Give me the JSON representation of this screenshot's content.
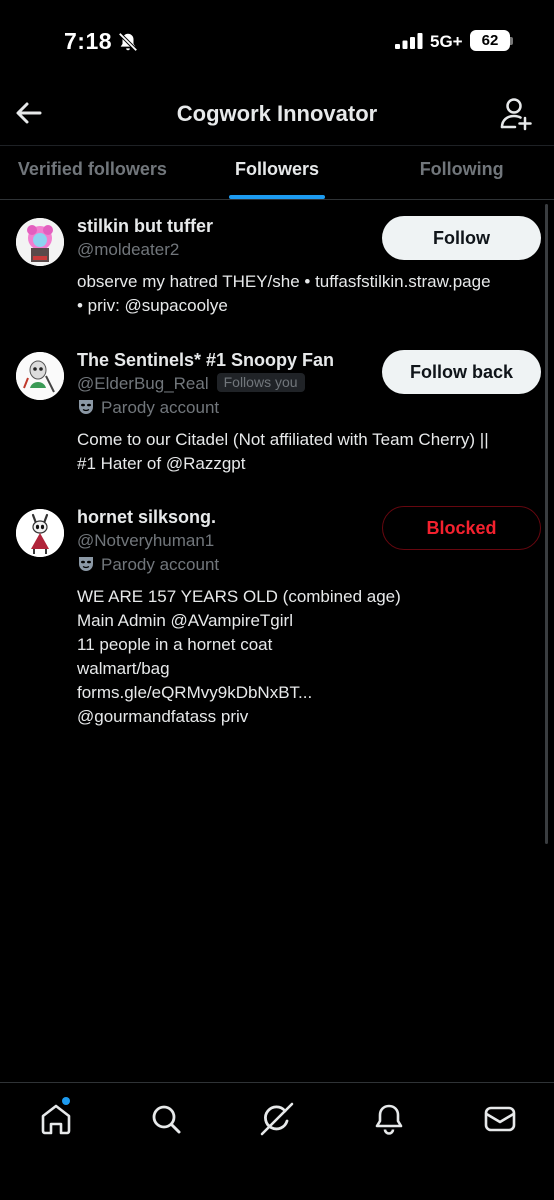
{
  "status_bar": {
    "time": "7:18",
    "network": "5G+",
    "battery": "62"
  },
  "header": {
    "title": "Cogwork Innovator"
  },
  "tabs": [
    {
      "label": "Verified followers",
      "active": false
    },
    {
      "label": "Followers",
      "active": true
    },
    {
      "label": "Following",
      "active": false
    }
  ],
  "followers": [
    {
      "name": "stilkin but tuffer",
      "handle": "@moldeater2",
      "button": "Follow",
      "bio": [
        "observe my hatred THEY/she • tuffasfstilkin.straw.page",
        "• priv: @supacoolye"
      ]
    },
    {
      "name": "The Sentinels* #1 Snoopy Fan",
      "handle": "@ElderBug_Real",
      "follows_you": "Follows you",
      "parody": "Parody account",
      "button": "Follow back",
      "bio": [
        "Come to our Citadel (Not affiliated with Team Cherry) ||",
        "#1 Hater of @Razzgpt"
      ]
    },
    {
      "name": "hornet silksong.",
      "handle": "@Notveryhuman1",
      "parody": "Parody account",
      "button": "Blocked",
      "bio": [
        "WE ARE 157 YEARS OLD (combined age)",
        "Main Admin @AVampireTgirl",
        "11 people in a hornet coat",
        "walmart/bag",
        "forms.gle/eQRMvy9kDbNxBT...",
        "@gourmandfatass priv"
      ]
    }
  ],
  "bottom_nav": [
    "home-icon",
    "search-icon",
    "grok-icon",
    "notifications-icon",
    "messages-icon"
  ],
  "colors": {
    "accent": "#1d9bf0",
    "blocked": "#f4212e",
    "muted": "#71767b"
  }
}
